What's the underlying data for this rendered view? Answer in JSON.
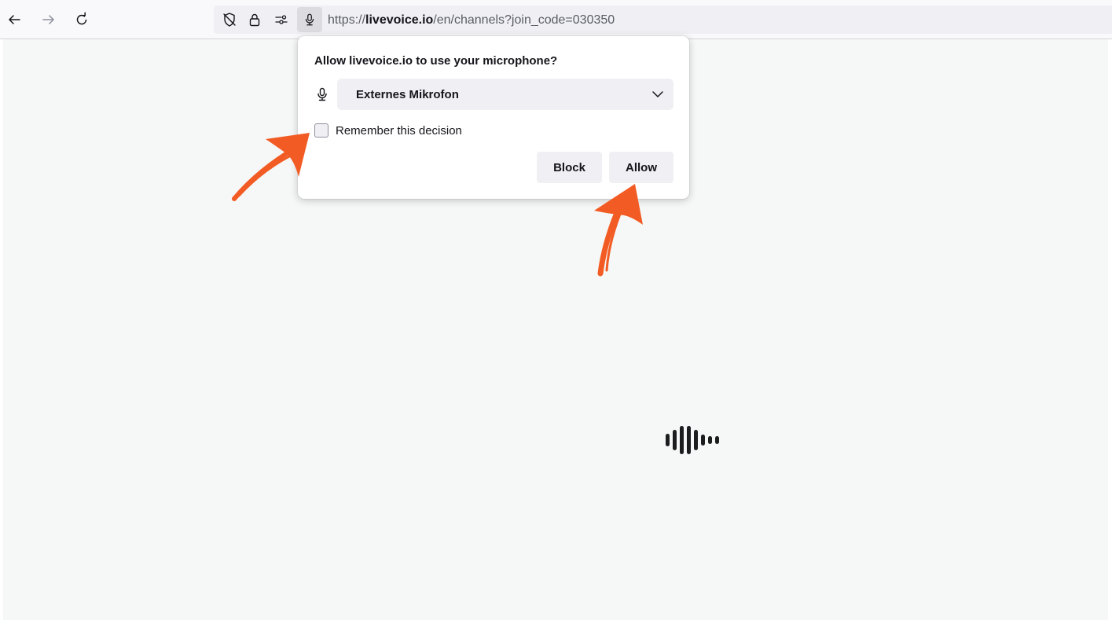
{
  "browser": {
    "url_scheme": "https://",
    "url_host": "livevoice.io",
    "url_path": "/en/channels?join_code=030350"
  },
  "permission_prompt": {
    "title": "Allow livevoice.io to use your microphone?",
    "device_selected": "Externes Mikrofon",
    "remember_label": "Remember this decision",
    "remember_checked": false,
    "block_label": "Block",
    "allow_label": "Allow"
  },
  "colors": {
    "annotation_arrow": "#f25c24",
    "page_background": "#f6f7f7",
    "toolbar_background": "#f9f9fb",
    "button_background": "#f0f0f4"
  },
  "icons": {
    "back": "arrow-left-icon",
    "forward": "arrow-right-icon",
    "reload": "reload-icon",
    "tracking": "shield-slash-icon",
    "lock": "lock-icon",
    "permissions": "sliders-icon",
    "microphone": "microphone-icon",
    "dropdown": "chevron-down-icon",
    "loader": "audio-waveform-icon"
  }
}
